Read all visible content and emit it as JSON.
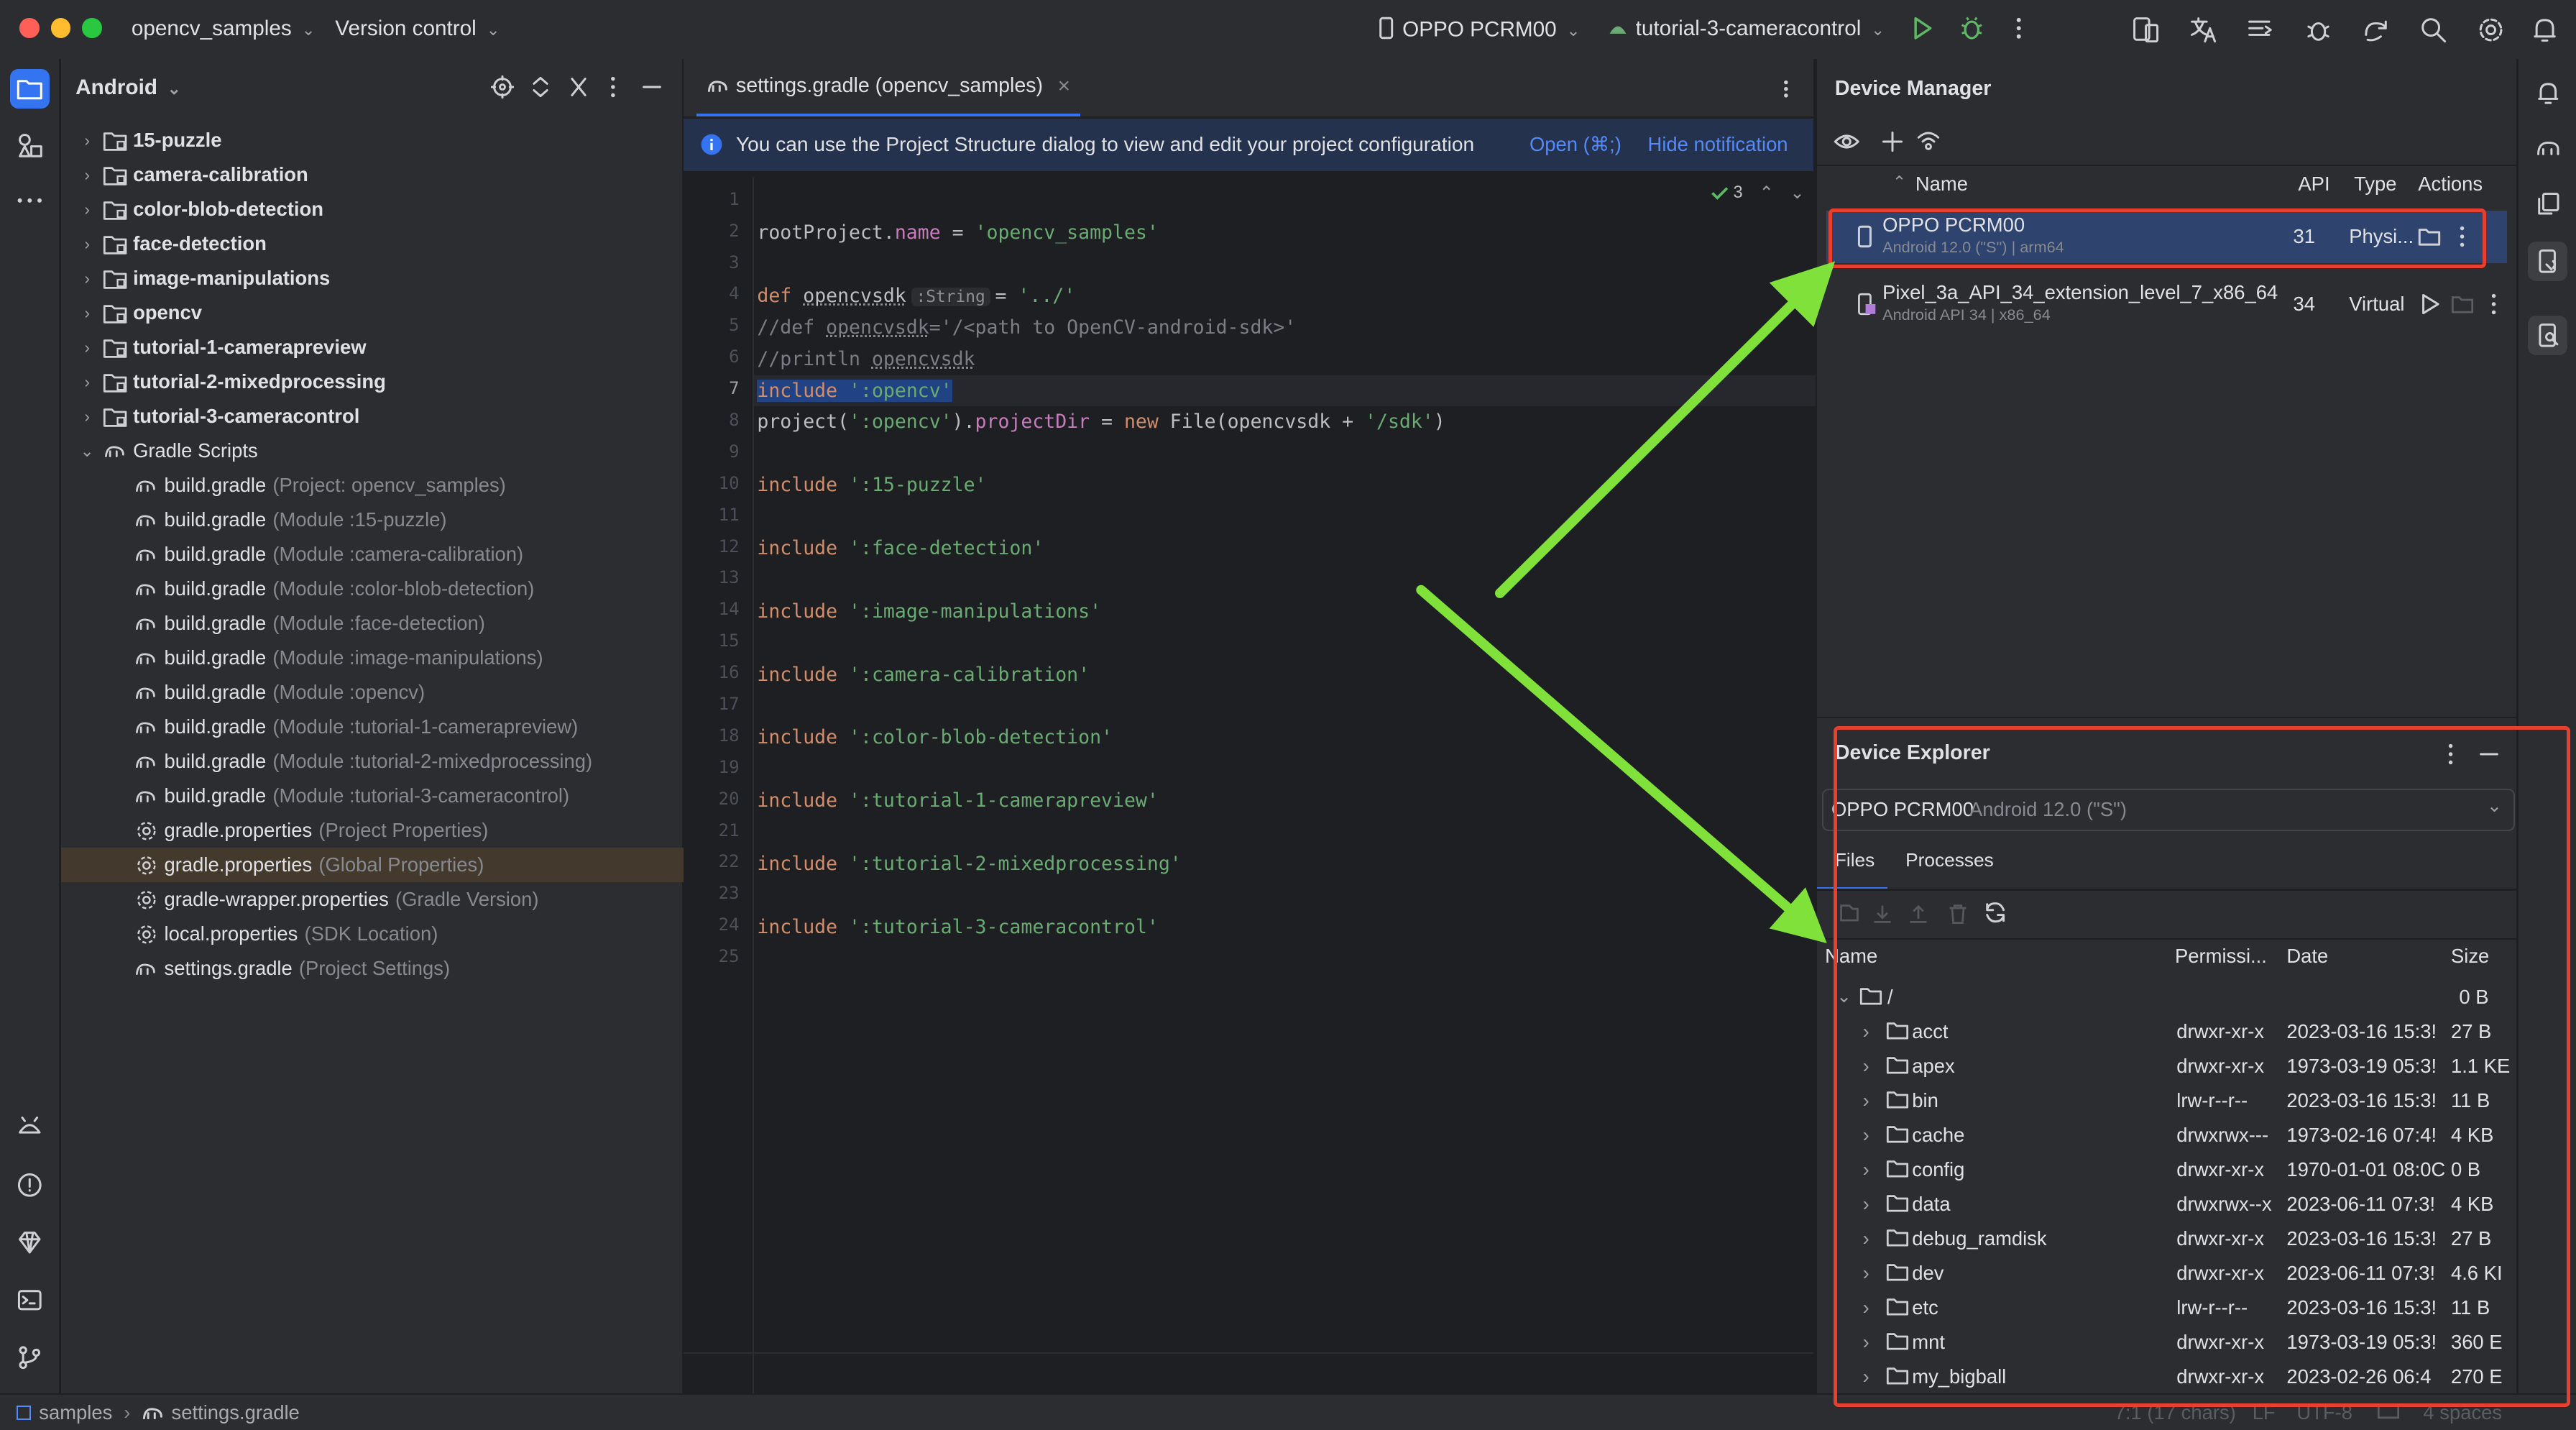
{
  "window": {
    "project_name": "opencv_samples",
    "vcs_label": "Version control",
    "device_selector": "OPPO PCRM00",
    "run_config": "tutorial-3-cameracontrol"
  },
  "project_panel": {
    "view_mode": "Android",
    "modules": [
      {
        "name": "15-puzzle"
      },
      {
        "name": "camera-calibration"
      },
      {
        "name": "color-blob-detection"
      },
      {
        "name": "face-detection"
      },
      {
        "name": "image-manipulations"
      },
      {
        "name": "opencv"
      },
      {
        "name": "tutorial-1-camerapreview"
      },
      {
        "name": "tutorial-2-mixedprocessing"
      },
      {
        "name": "tutorial-3-cameracontrol"
      }
    ],
    "gradle_scripts_label": "Gradle Scripts",
    "gradle_files": [
      {
        "name": "build.gradle",
        "hint": "(Project: opencv_samples)",
        "icon": "gradle-icon"
      },
      {
        "name": "build.gradle",
        "hint": "(Module :15-puzzle)",
        "icon": "gradle-icon"
      },
      {
        "name": "build.gradle",
        "hint": "(Module :camera-calibration)",
        "icon": "gradle-icon"
      },
      {
        "name": "build.gradle",
        "hint": "(Module :color-blob-detection)",
        "icon": "gradle-icon"
      },
      {
        "name": "build.gradle",
        "hint": "(Module :face-detection)",
        "icon": "gradle-icon"
      },
      {
        "name": "build.gradle",
        "hint": "(Module :image-manipulations)",
        "icon": "gradle-icon"
      },
      {
        "name": "build.gradle",
        "hint": "(Module :opencv)",
        "icon": "gradle-icon"
      },
      {
        "name": "build.gradle",
        "hint": "(Module :tutorial-1-camerapreview)",
        "icon": "gradle-icon"
      },
      {
        "name": "build.gradle",
        "hint": "(Module :tutorial-2-mixedprocessing)",
        "icon": "gradle-icon"
      },
      {
        "name": "build.gradle",
        "hint": "(Module :tutorial-3-cameracontrol)",
        "icon": "gradle-icon"
      },
      {
        "name": "gradle.properties",
        "hint": "(Project Properties)",
        "icon": "settings-icon"
      },
      {
        "name": "gradle.properties",
        "hint": "(Global Properties)",
        "icon": "settings-icon"
      },
      {
        "name": "gradle-wrapper.properties",
        "hint": "(Gradle Version)",
        "icon": "settings-icon"
      },
      {
        "name": "local.properties",
        "hint": "(SDK Location)",
        "icon": "settings-icon"
      },
      {
        "name": "settings.gradle",
        "hint": "(Project Settings)",
        "icon": "gradle-icon"
      }
    ]
  },
  "editor": {
    "tab_label": "settings.gradle (opencv_samples)",
    "notification": "You can use the Project Structure dialog to view and edit your project configuration",
    "notification_open": "Open (⌘;)",
    "notification_hide": "Hide notification",
    "problem_count": "3",
    "current_line": 7,
    "inlay_hint": ":String",
    "lines": [
      "",
      "rootProject.name = 'opencv_samples'",
      "",
      "def opencvsdk = '../'",
      "//def opencvsdk='/<path to OpenCV-android-sdk>'",
      "//println opencvsdk",
      "include ':opencv'",
      "project(':opencv').projectDir = new File(opencvsdk + '/sdk')",
      "",
      "include ':15-puzzle'",
      "",
      "include ':face-detection'",
      "",
      "include ':image-manipulations'",
      "",
      "include ':camera-calibration'",
      "",
      "include ':color-blob-detection'",
      "",
      "include ':tutorial-1-camerapreview'",
      "",
      "include ':tutorial-2-mixedprocessing'",
      "",
      "include ':tutorial-3-cameracontrol'",
      ""
    ]
  },
  "device_manager": {
    "title": "Device Manager",
    "columns": {
      "name": "Name",
      "api": "API",
      "type": "Type",
      "actions": "Actions"
    },
    "devices": [
      {
        "name": "OPPO PCRM00",
        "sub": "Android 12.0 (\"S\") | arm64",
        "api": "31",
        "type": "Physi..."
      },
      {
        "name": "Pixel_3a_API_34_extension_level_7_x86_64",
        "sub": "Android API 34 | x86_64",
        "api": "34",
        "type": "Virtual"
      }
    ]
  },
  "device_explorer": {
    "title": "Device Explorer",
    "device_name": "OPPO PCRM00",
    "device_detail": "Android 12.0 (\"S\")",
    "tabs": [
      "Files",
      "Processes"
    ],
    "columns": {
      "name": "Name",
      "permissions": "Permissi...",
      "date": "Date",
      "size": "Size"
    },
    "root": {
      "name": "/",
      "size": "0 B"
    },
    "entries": [
      {
        "name": "acct",
        "perm": "drwxr-xr-x",
        "date": "2023-03-16 15:3!",
        "size": "27 B"
      },
      {
        "name": "apex",
        "perm": "drwxr-xr-x",
        "date": "1973-03-19 05:3!",
        "size": "1.1 KE"
      },
      {
        "name": "bin",
        "perm": "lrw-r--r--",
        "date": "2023-03-16 15:3!",
        "size": "11 B"
      },
      {
        "name": "cache",
        "perm": "drwxrwx---",
        "date": "1973-02-16 07:4!",
        "size": "4 KB"
      },
      {
        "name": "config",
        "perm": "drwxr-xr-x",
        "date": "1970-01-01 08:0C",
        "size": "0 B"
      },
      {
        "name": "data",
        "perm": "drwxrwx--x",
        "date": "2023-06-11 07:3!",
        "size": "4 KB"
      },
      {
        "name": "debug_ramdisk",
        "perm": "drwxr-xr-x",
        "date": "2023-03-16 15:3!",
        "size": "27 B"
      },
      {
        "name": "dev",
        "perm": "drwxr-xr-x",
        "date": "2023-06-11 07:3!",
        "size": "4.6 KI"
      },
      {
        "name": "etc",
        "perm": "lrw-r--r--",
        "date": "2023-03-16 15:3!",
        "size": "11 B"
      },
      {
        "name": "mnt",
        "perm": "drwxr-xr-x",
        "date": "1973-03-19 05:3!",
        "size": "360 E"
      },
      {
        "name": "my_bigball",
        "perm": "drwxr-xr-x",
        "date": "2023-02-26 06:4",
        "size": "270 E"
      }
    ]
  },
  "statusbar": {
    "breadcrumb_root": "samples",
    "breadcrumb_file": "settings.gradle",
    "position": "7:1 (17 chars)",
    "line_sep": "LF",
    "encoding": "UTF-8",
    "indent": "4 spaces"
  },
  "colors": {
    "accent": "#3574f0",
    "annotation_arrow": "#7fe13a",
    "annotation_box": "#e8402e"
  }
}
